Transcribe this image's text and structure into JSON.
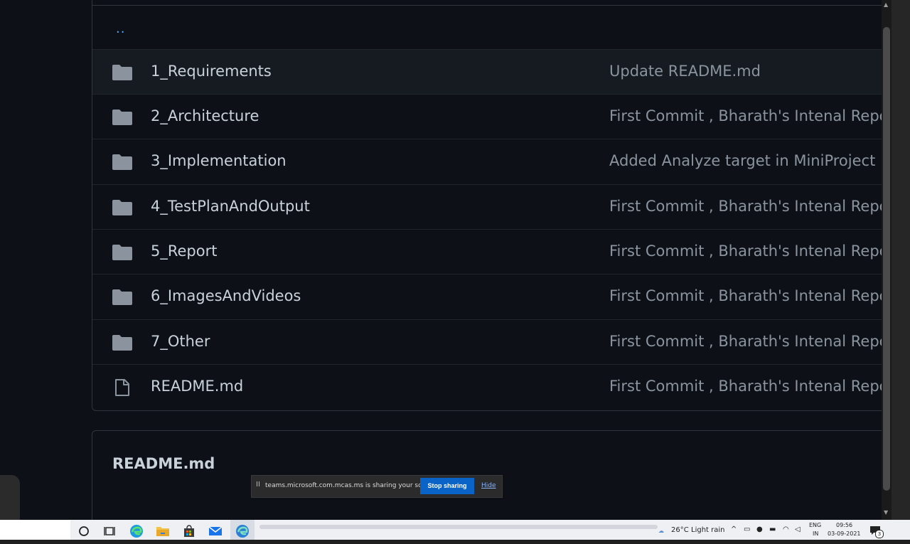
{
  "file_list": {
    "parent_link": "..",
    "rows": [
      {
        "name": "1_Requirements",
        "message": "Update README.md",
        "icon": "folder-icon"
      },
      {
        "name": "2_Architecture",
        "message": "First Commit , Bharath's Intenal Repo",
        "icon": "folder-icon"
      },
      {
        "name": "3_Implementation",
        "message": "Added Analyze target in MiniProject",
        "icon": "folder-icon"
      },
      {
        "name": "4_TestPlanAndOutput",
        "message": "First Commit , Bharath's Intenal Repo",
        "icon": "folder-icon"
      },
      {
        "name": "5_Report",
        "message": "First Commit , Bharath's Intenal Repo",
        "icon": "folder-icon"
      },
      {
        "name": "6_ImagesAndVideos",
        "message": "First Commit , Bharath's Intenal Repo",
        "icon": "folder-icon"
      },
      {
        "name": "7_Other",
        "message": "First Commit , Bharath's Intenal Repo",
        "icon": "folder-icon"
      },
      {
        "name": "README.md",
        "message": "First Commit , Bharath's Intenal Repo",
        "icon": "file-icon"
      }
    ]
  },
  "readme": {
    "title": "README.md"
  },
  "share_notification": {
    "grip": "II",
    "text": "teams.microsoft.com.mcas.ms is sharing your screen.",
    "stop_label": "Stop sharing",
    "hide_label": "Hide"
  },
  "taskbar": {
    "icons": [
      "cortana-icon",
      "task-view-icon",
      "edge-icon",
      "file-explorer-icon",
      "store-icon",
      "mail-icon",
      "edge-dev-icon"
    ],
    "weather": {
      "temp": "26°C",
      "condition": "Light rain"
    },
    "language": {
      "line1": "ENG",
      "line2": "IN"
    },
    "clock": {
      "time": "09:56",
      "date": "03-09-2021"
    },
    "notification_count": "3"
  },
  "colors": {
    "background": "#0d1117",
    "link": "#58a6ff",
    "muted_text": "#8b949e",
    "primary_text": "#c9d1d9",
    "share_button": "#0a64c8"
  }
}
